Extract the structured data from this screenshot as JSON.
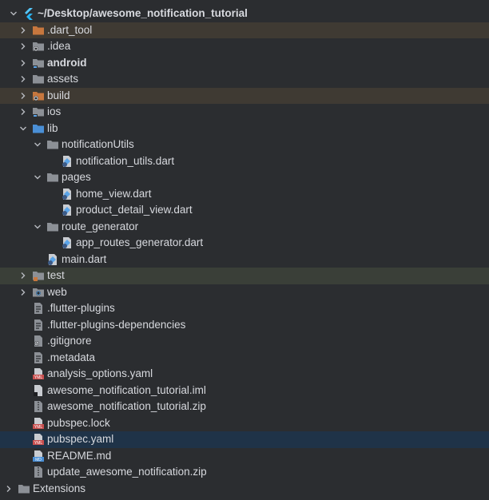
{
  "project_root": {
    "label": "~/Desktop/awesome_notification_tutorial",
    "icon": "flutter-icon"
  },
  "items": [
    {
      "label": ".dart_tool",
      "icon": "folder-orange-icon"
    },
    {
      "label": ".idea",
      "icon": "folder-gear-icon"
    },
    {
      "label": "android",
      "icon": "folder-module-icon"
    },
    {
      "label": "assets",
      "icon": "folder-icon"
    },
    {
      "label": "build",
      "icon": "folder-gear-orange-icon"
    },
    {
      "label": "ios",
      "icon": "folder-module-icon"
    },
    {
      "label": "lib",
      "icon": "folder-source-icon"
    },
    {
      "label": "notificationUtils",
      "icon": "folder-icon"
    },
    {
      "label": "notification_utils.dart",
      "icon": "dart-file-icon"
    },
    {
      "label": "pages",
      "icon": "folder-icon"
    },
    {
      "label": "home_view.dart",
      "icon": "dart-file-icon"
    },
    {
      "label": "product_detail_view.dart",
      "icon": "dart-file-icon"
    },
    {
      "label": "route_generator",
      "icon": "folder-icon"
    },
    {
      "label": "app_routes_generator.dart",
      "icon": "dart-file-icon"
    },
    {
      "label": "main.dart",
      "icon": "dart-file-icon"
    },
    {
      "label": "test",
      "icon": "folder-test-icon"
    },
    {
      "label": "web",
      "icon": "folder-web-icon"
    },
    {
      "label": ".flutter-plugins",
      "icon": "text-file-icon"
    },
    {
      "label": ".flutter-plugins-dependencies",
      "icon": "text-file-icon"
    },
    {
      "label": ".gitignore",
      "icon": "ignore-file-icon"
    },
    {
      "label": ".metadata",
      "icon": "text-file-icon"
    },
    {
      "label": "analysis_options.yaml",
      "icon": "yaml-file-icon"
    },
    {
      "label": "awesome_notification_tutorial.iml",
      "icon": "iml-file-icon"
    },
    {
      "label": "awesome_notification_tutorial.zip",
      "icon": "zip-file-icon"
    },
    {
      "label": "pubspec.lock",
      "icon": "yaml-file-icon"
    },
    {
      "label": "pubspec.yaml",
      "icon": "yaml-file-icon"
    },
    {
      "label": "README.md",
      "icon": "markdown-file-icon"
    },
    {
      "label": "update_awesome_notification.zip",
      "icon": "zip-file-icon"
    }
  ],
  "extensions": {
    "label": "Extensions",
    "icon": "folder-icon"
  },
  "colors": {
    "selected": "#1f3348",
    "modified_green": "#3a3f38",
    "excluded_orange": "#3f3a33",
    "folder": "#8c9096",
    "yaml_red": "#c94f4f",
    "markdown_blue": "#4a8fd6",
    "dart_blue": "#5aa4e8"
  }
}
